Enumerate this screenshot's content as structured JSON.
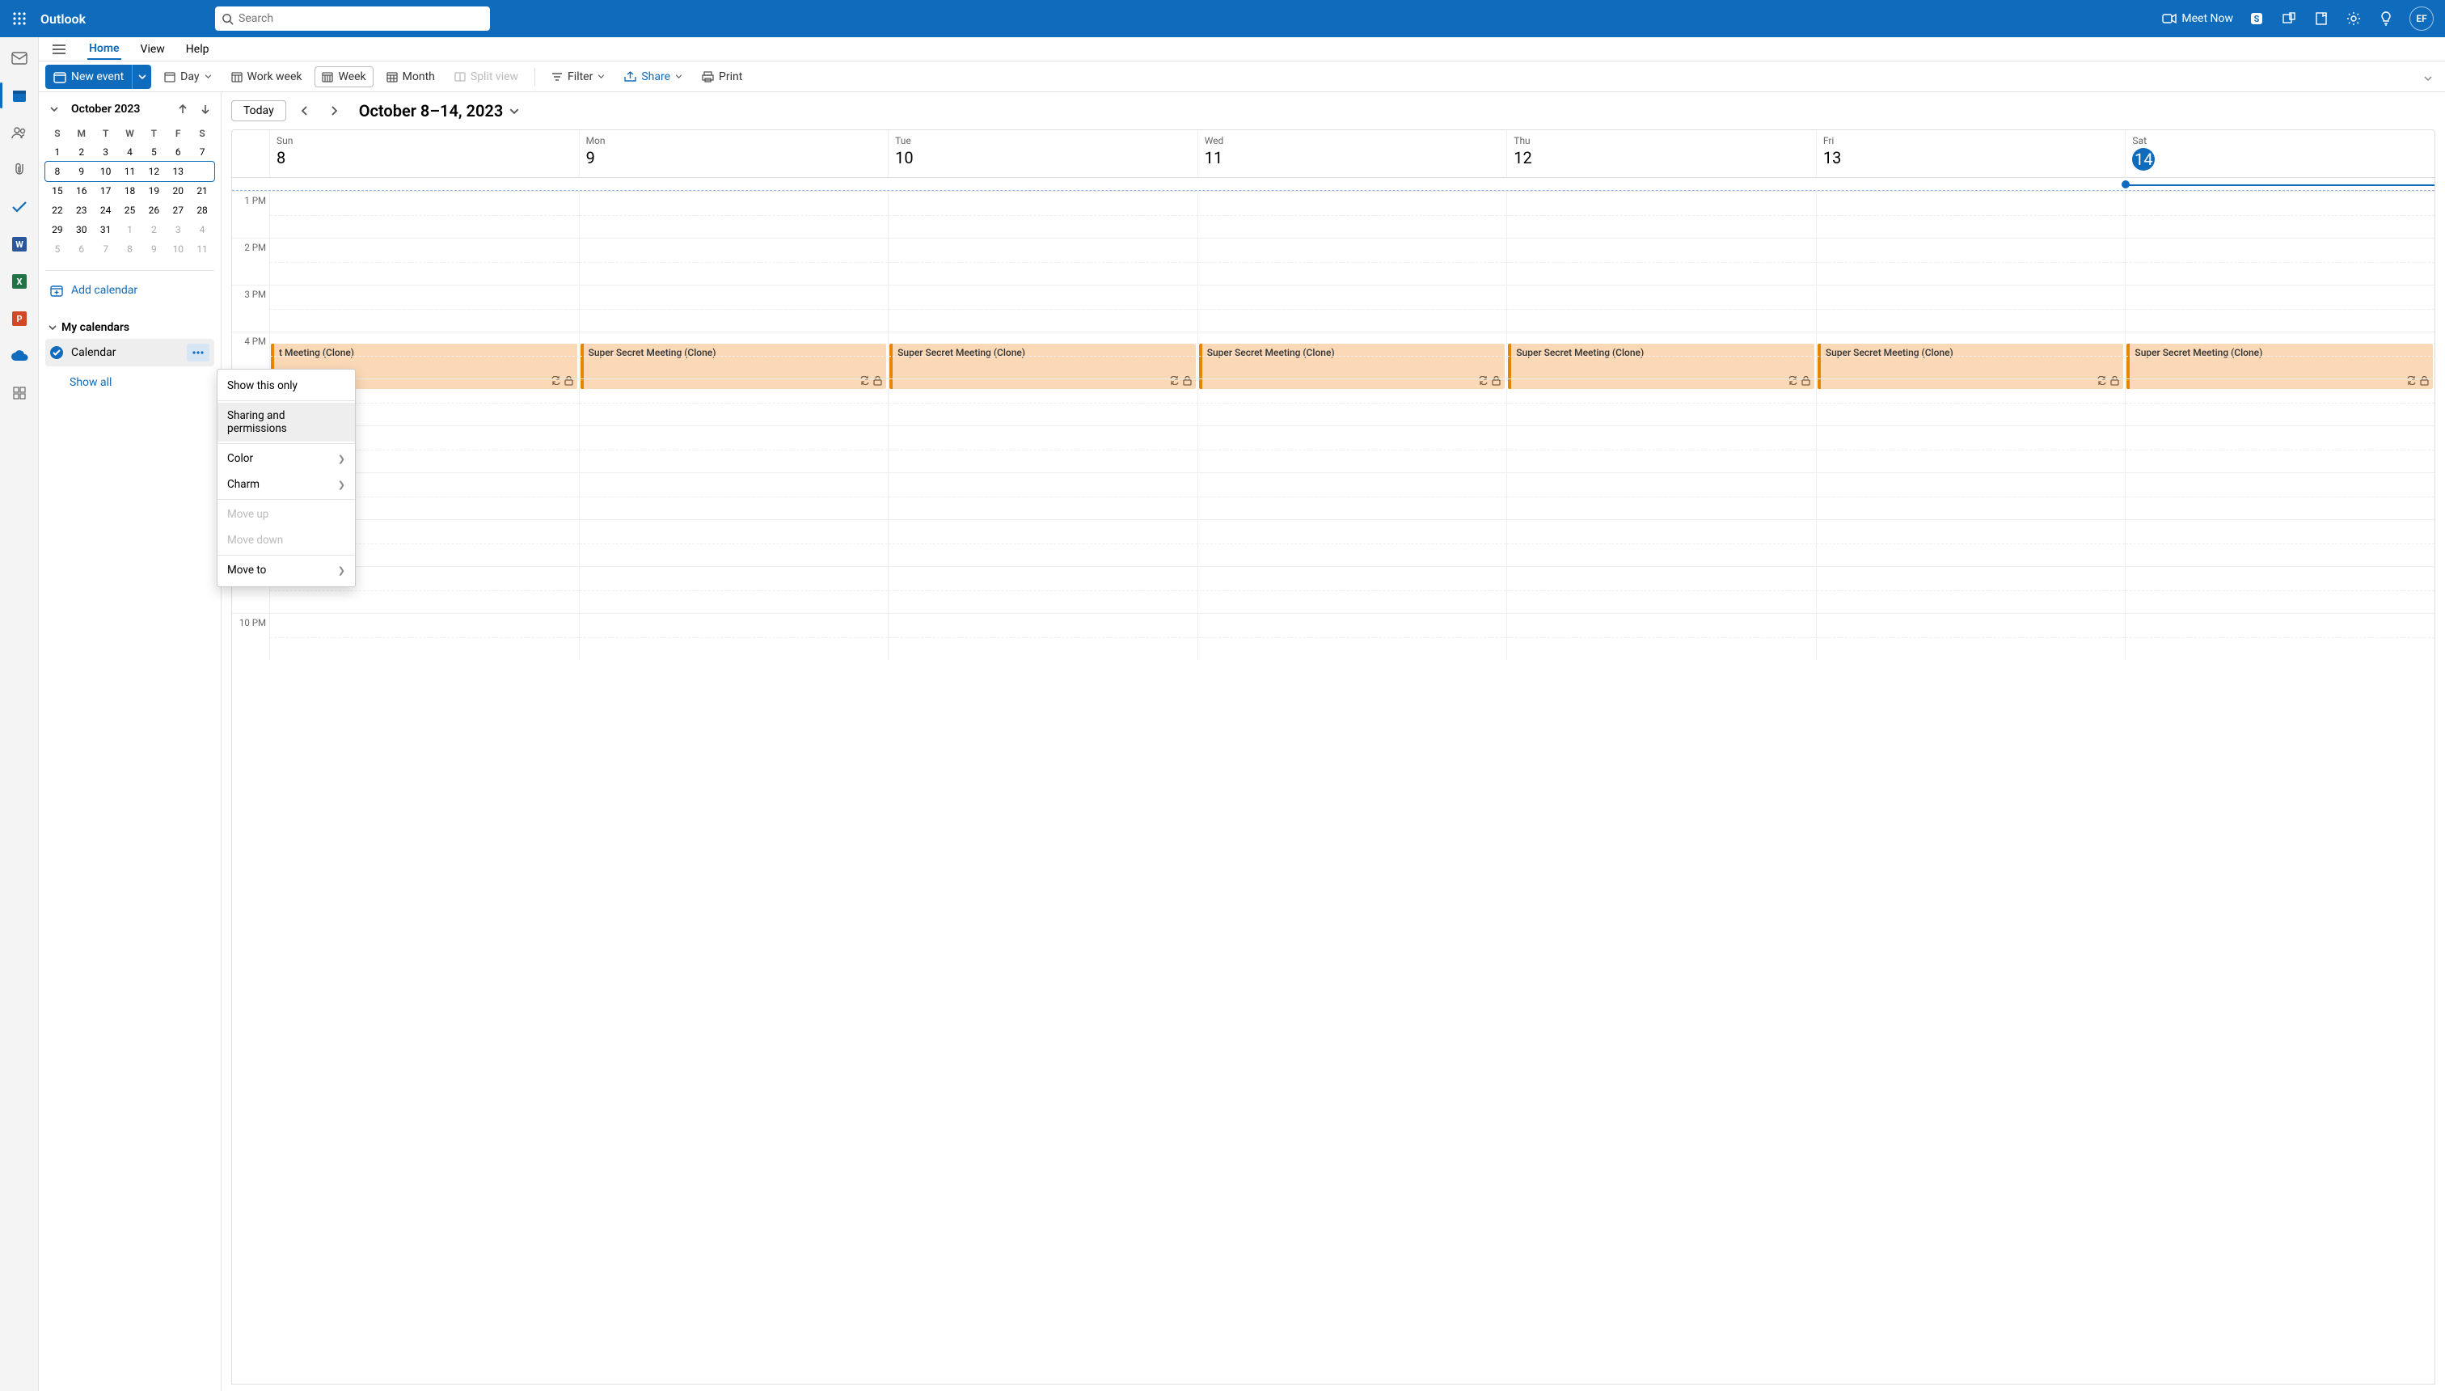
{
  "brand": "Outlook",
  "search": {
    "placeholder": "Search"
  },
  "meet_now_label": "Meet Now",
  "avatar_initials": "EF",
  "tabs": {
    "home": "Home",
    "view": "View",
    "help": "Help"
  },
  "toolbar": {
    "new_event": "New event",
    "day": "Day",
    "work_week": "Work week",
    "week": "Week",
    "month": "Month",
    "split_view": "Split view",
    "filter": "Filter",
    "share": "Share",
    "print": "Print"
  },
  "sidebar": {
    "month_title": "October 2023",
    "dow": [
      "S",
      "M",
      "T",
      "W",
      "T",
      "F",
      "S"
    ],
    "weeks": [
      [
        {
          "n": "1"
        },
        {
          "n": "2"
        },
        {
          "n": "3"
        },
        {
          "n": "4"
        },
        {
          "n": "5"
        },
        {
          "n": "6"
        },
        {
          "n": "7"
        }
      ],
      [
        {
          "n": "8"
        },
        {
          "n": "9"
        },
        {
          "n": "10"
        },
        {
          "n": "11"
        },
        {
          "n": "12"
        },
        {
          "n": "13"
        },
        {
          "n": "14",
          "today": true
        }
      ],
      [
        {
          "n": "15"
        },
        {
          "n": "16"
        },
        {
          "n": "17"
        },
        {
          "n": "18"
        },
        {
          "n": "19"
        },
        {
          "n": "20"
        },
        {
          "n": "21"
        }
      ],
      [
        {
          "n": "22"
        },
        {
          "n": "23"
        },
        {
          "n": "24"
        },
        {
          "n": "25"
        },
        {
          "n": "26"
        },
        {
          "n": "27"
        },
        {
          "n": "28"
        }
      ],
      [
        {
          "n": "29"
        },
        {
          "n": "30"
        },
        {
          "n": "31"
        },
        {
          "n": "1",
          "other": true
        },
        {
          "n": "2",
          "other": true
        },
        {
          "n": "3",
          "other": true
        },
        {
          "n": "4",
          "other": true
        }
      ],
      [
        {
          "n": "5",
          "other": true
        },
        {
          "n": "6",
          "other": true
        },
        {
          "n": "7",
          "other": true
        },
        {
          "n": "8",
          "other": true
        },
        {
          "n": "9",
          "other": true
        },
        {
          "n": "10",
          "other": true
        },
        {
          "n": "11",
          "other": true
        }
      ]
    ],
    "selected_week_index": 1,
    "add_calendar": "Add calendar",
    "my_calendars": "My calendars",
    "calendar_item": "Calendar",
    "show_all": "Show all"
  },
  "context_menu": {
    "show_only": "Show this only",
    "sharing": "Sharing and permissions",
    "color": "Color",
    "charm": "Charm",
    "move_up": "Move up",
    "move_down": "Move down",
    "move_to": "Move to"
  },
  "cal_header": {
    "today": "Today",
    "range": "October 8–14, 2023"
  },
  "days": [
    {
      "dow": "Sun",
      "num": "8"
    },
    {
      "dow": "Mon",
      "num": "9"
    },
    {
      "dow": "Tue",
      "num": "10"
    },
    {
      "dow": "Wed",
      "num": "11"
    },
    {
      "dow": "Thu",
      "num": "12"
    },
    {
      "dow": "Fri",
      "num": "13"
    },
    {
      "dow": "Sat",
      "num": "14",
      "today": true
    }
  ],
  "hours": [
    "1 PM",
    "2 PM",
    "3 PM",
    "4 PM",
    "",
    "",
    "",
    "",
    "",
    "10 PM"
  ],
  "event_title_full": "Super Secret Meeting (Clone)",
  "event_title_clipped": "t Meeting (Clone)"
}
